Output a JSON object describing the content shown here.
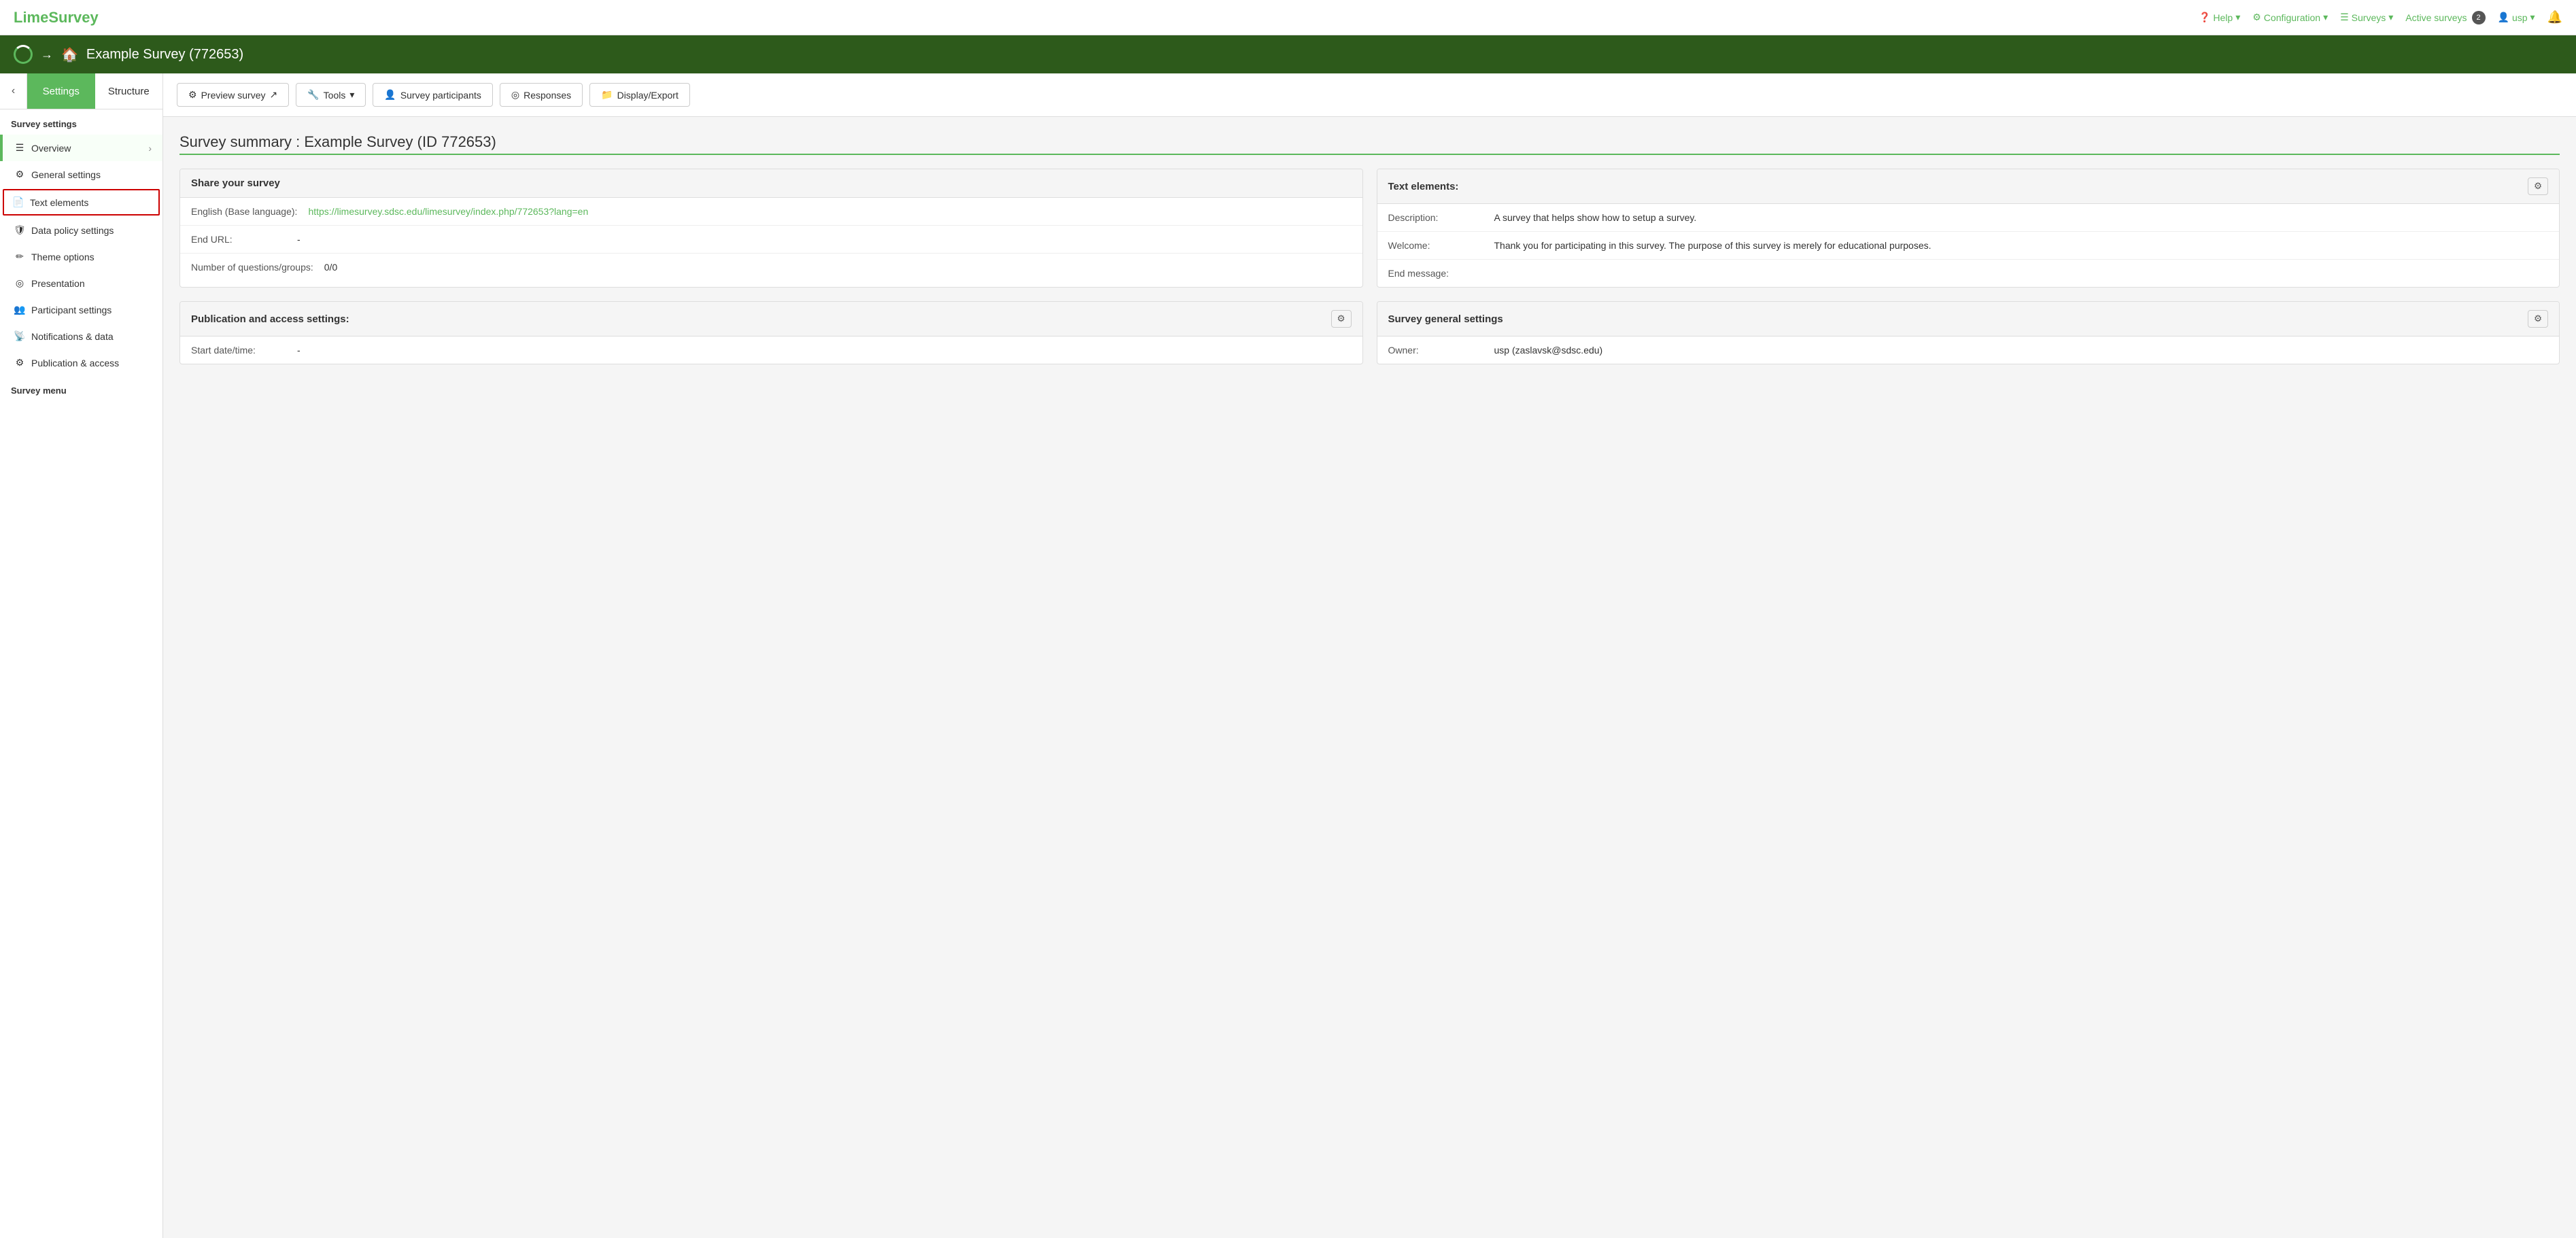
{
  "brand": {
    "name": "LimeSurvey"
  },
  "topnav": {
    "help": "Help",
    "configuration": "Configuration",
    "surveys": "Surveys",
    "active_surveys": "Active surveys",
    "active_count": "2",
    "user": "usp"
  },
  "breadcrumb": {
    "title": "Example Survey (772653)"
  },
  "sidebar": {
    "back_label": "‹",
    "tab_settings": "Settings",
    "tab_structure": "Structure",
    "section_title": "Survey settings",
    "items": [
      {
        "id": "overview",
        "icon": "☰",
        "label": "Overview",
        "has_chevron": true,
        "active": true,
        "highlighted": false
      },
      {
        "id": "general-settings",
        "icon": "⚙",
        "label": "General settings",
        "has_chevron": false,
        "active": false,
        "highlighted": false
      },
      {
        "id": "text-elements",
        "icon": "📄",
        "label": "Text elements",
        "has_chevron": false,
        "active": false,
        "highlighted": true
      },
      {
        "id": "data-policy",
        "icon": "🛡",
        "label": "Data policy settings",
        "has_chevron": false,
        "active": false,
        "highlighted": false
      },
      {
        "id": "theme-options",
        "icon": "✏",
        "label": "Theme options",
        "has_chevron": false,
        "active": false,
        "highlighted": false
      },
      {
        "id": "presentation",
        "icon": "◎",
        "label": "Presentation",
        "has_chevron": false,
        "active": false,
        "highlighted": false
      },
      {
        "id": "participant-settings",
        "icon": "👥",
        "label": "Participant settings",
        "has_chevron": false,
        "active": false,
        "highlighted": false
      },
      {
        "id": "notifications",
        "icon": "📡",
        "label": "Notifications & data",
        "has_chevron": false,
        "active": false,
        "highlighted": false
      },
      {
        "id": "publication-access",
        "icon": "⚙",
        "label": "Publication & access",
        "has_chevron": false,
        "active": false,
        "highlighted": false
      }
    ],
    "survey_menu_label": "Survey menu"
  },
  "toolbar": {
    "buttons": [
      {
        "id": "preview-survey",
        "icon": "⚙",
        "label": "Preview survey",
        "has_arrow": false,
        "has_external": true
      },
      {
        "id": "tools",
        "icon": "🔧",
        "label": "Tools",
        "has_arrow": true
      },
      {
        "id": "survey-participants",
        "icon": "👤",
        "label": "Survey participants"
      },
      {
        "id": "responses",
        "icon": "◎",
        "label": "Responses"
      },
      {
        "id": "display-export",
        "icon": "📁",
        "label": "Display/Export"
      }
    ]
  },
  "page": {
    "title": "Survey summary : Example Survey (ID 772653)"
  },
  "cards": [
    {
      "id": "share-survey",
      "header": "Share your survey",
      "has_gear": false,
      "rows": [
        {
          "label": "English (Base language):",
          "value": "https://limesurvey.sdsc.edu/limesurvey/index.php/772653?lang=en",
          "is_link": true
        },
        {
          "label": "End URL:",
          "value": "-",
          "is_link": false
        },
        {
          "label": "Number of questions/groups:",
          "value": "0/0",
          "is_link": false
        }
      ]
    },
    {
      "id": "text-elements",
      "header": "Text elements:",
      "has_gear": true,
      "rows": [
        {
          "label": "Description:",
          "value": "A survey that helps show how to setup a survey.",
          "is_link": false
        },
        {
          "label": "Welcome:",
          "value": "Thank you for participating in this survey. The purpose of this survey is merely for educational purposes.",
          "is_link": false
        },
        {
          "label": "End message:",
          "value": "",
          "is_link": false
        }
      ]
    },
    {
      "id": "publication-access-settings",
      "header": "Publication and access settings:",
      "has_gear": true,
      "rows": [
        {
          "label": "Start date/time:",
          "value": "-",
          "is_link": false
        }
      ]
    },
    {
      "id": "survey-general-settings",
      "header": "Survey general settings",
      "has_gear": true,
      "rows": [
        {
          "label": "Owner:",
          "value": "usp (zaslavsk@sdsc.edu)",
          "is_link": false
        }
      ]
    }
  ]
}
